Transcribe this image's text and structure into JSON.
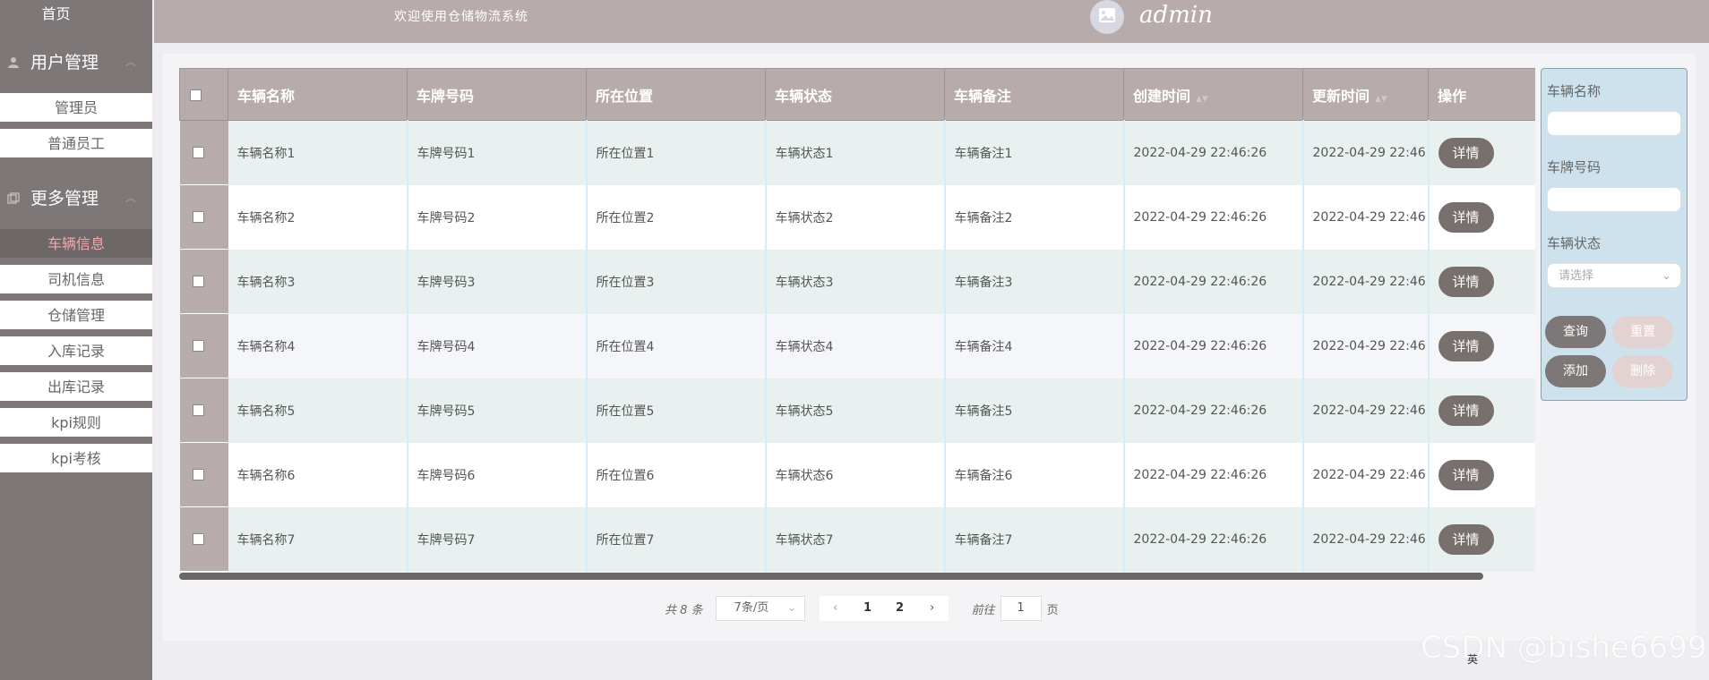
{
  "sidebar": {
    "home": "首页",
    "group_user": "用户管理",
    "user_items": [
      "管理员",
      "普通员工"
    ],
    "group_more": "更多管理",
    "more_items": [
      "车辆信息",
      "司机信息",
      "仓储管理",
      "入库记录",
      "出库记录",
      "kpi规则",
      "kpi考核"
    ]
  },
  "header": {
    "welcome": "欢迎使用仓储物流系统",
    "username": "admin"
  },
  "table": {
    "columns": [
      "车辆名称",
      "车牌号码",
      "所在位置",
      "车辆状态",
      "车辆备注",
      "创建时间",
      "更新时间",
      "操作"
    ],
    "rows": [
      [
        "车辆名称1",
        "车牌号码1",
        "所在位置1",
        "车辆状态1",
        "车辆备注1",
        "2022-04-29 22:46:26",
        "2022-04-29 22:46"
      ],
      [
        "车辆名称2",
        "车牌号码2",
        "所在位置2",
        "车辆状态2",
        "车辆备注2",
        "2022-04-29 22:46:26",
        "2022-04-29 22:46"
      ],
      [
        "车辆名称3",
        "车牌号码3",
        "所在位置3",
        "车辆状态3",
        "车辆备注3",
        "2022-04-29 22:46:26",
        "2022-04-29 22:46"
      ],
      [
        "车辆名称4",
        "车牌号码4",
        "所在位置4",
        "车辆状态4",
        "车辆备注4",
        "2022-04-29 22:46:26",
        "2022-04-29 22:46"
      ],
      [
        "车辆名称5",
        "车牌号码5",
        "所在位置5",
        "车辆状态5",
        "车辆备注5",
        "2022-04-29 22:46:26",
        "2022-04-29 22:46"
      ],
      [
        "车辆名称6",
        "车牌号码6",
        "所在位置6",
        "车辆状态6",
        "车辆备注6",
        "2022-04-29 22:46:26",
        "2022-04-29 22:46"
      ],
      [
        "车辆名称7",
        "车牌号码7",
        "所在位置7",
        "车辆状态7",
        "车辆备注7",
        "2022-04-29 22:46:26",
        "2022-04-29 22:46"
      ]
    ],
    "detail_label": "详情"
  },
  "search": {
    "name_label": "车辆名称",
    "plate_label": "车牌号码",
    "status_label": "车辆状态",
    "status_placeholder": "请选择",
    "query": "查询",
    "reset": "重置",
    "add": "添加",
    "delete": "删除"
  },
  "pager": {
    "total": "共 8 条",
    "page_size": "7条/页",
    "pages": [
      "1",
      "2"
    ],
    "goto": "前往",
    "goto_value": "1",
    "page_unit": "页"
  },
  "watermark": "CSDN @bishe6699",
  "ime_hint": "英",
  "colors": {
    "sidebar": "#7d7777",
    "header": "#b7abab",
    "active_text": "#f4a6ad",
    "button_dark": "#77706c"
  }
}
